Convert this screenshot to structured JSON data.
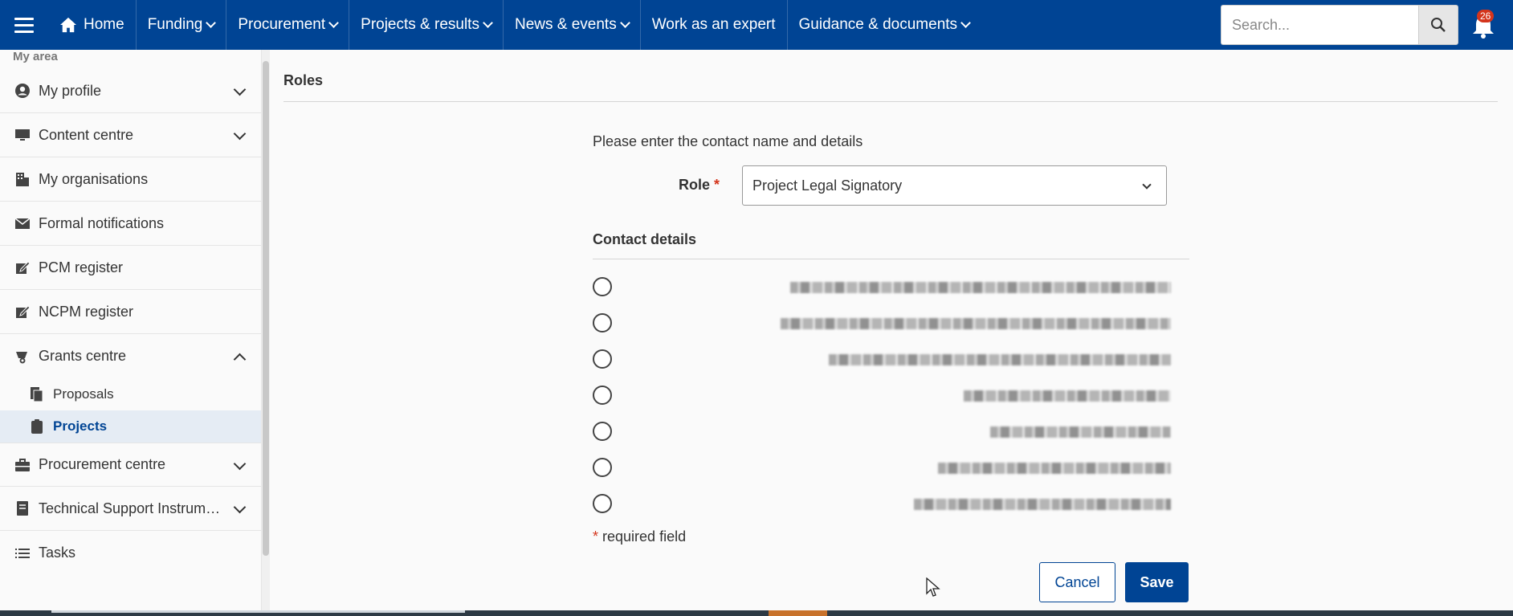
{
  "nav": {
    "items": [
      {
        "label": "Home"
      },
      {
        "label": "Funding"
      },
      {
        "label": "Procurement"
      },
      {
        "label": "Projects & results"
      },
      {
        "label": "News & events"
      },
      {
        "label": "Work as an expert"
      },
      {
        "label": "Guidance & documents"
      }
    ],
    "search_placeholder": "Search...",
    "notifications_count": "26"
  },
  "sidebar": {
    "section_label": "My area",
    "items": [
      {
        "label": "My profile",
        "icon": "user-circle-icon",
        "expandable": true
      },
      {
        "label": "Content centre",
        "icon": "monitor-icon",
        "expandable": true
      },
      {
        "label": "My organisations",
        "icon": "building-icon",
        "expandable": false
      },
      {
        "label": "Formal notifications",
        "icon": "envelope-icon",
        "expandable": false
      },
      {
        "label": "PCM register",
        "icon": "edit-box-icon",
        "expandable": false
      },
      {
        "label": "NCPM register",
        "icon": "edit-box-icon",
        "expandable": false
      },
      {
        "label": "Grants centre",
        "icon": "grants-icon",
        "expandable": true,
        "expanded": true
      },
      {
        "label": "Procurement centre",
        "icon": "briefcase-icon",
        "expandable": true
      },
      {
        "label": "Technical Support Instrum…",
        "icon": "document-icon",
        "expandable": true
      },
      {
        "label": "Tasks",
        "icon": "list-icon",
        "expandable": false
      }
    ],
    "sub_items": [
      {
        "label": "Proposals",
        "icon": "proposals-icon",
        "active": false
      },
      {
        "label": "Projects",
        "icon": "clipboard-icon",
        "active": true
      }
    ]
  },
  "main": {
    "title": "Roles",
    "intro": "Please enter the contact name and details",
    "role_label": "Role",
    "required_marker": "*",
    "role_value": "Project Legal Signatory",
    "contact_title": "Contact details",
    "contacts_count": 7,
    "required_note": "required field",
    "cancel_label": "Cancel",
    "save_label": "Save"
  },
  "colors": {
    "brand": "#004494",
    "required": "#d4351c",
    "active_bg": "#e5ecf4"
  }
}
